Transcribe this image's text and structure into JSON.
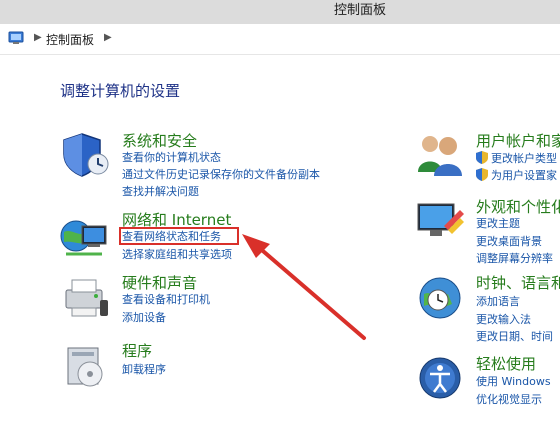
{
  "window": {
    "title": "控制面板"
  },
  "address": {
    "crumb": "控制面板"
  },
  "main": {
    "heading": "调整计算机的设置"
  },
  "left": [
    {
      "title": "系统和安全",
      "icon": "system-security-icon",
      "links": [
        "查看你的计算机状态",
        "通过文件历史记录保存你的文件备份副本",
        "查找并解决问题"
      ]
    },
    {
      "title": "网络和 Internet",
      "icon": "network-internet-icon",
      "links": [
        "查看网络状态和任务",
        "选择家庭组和共享选项"
      ]
    },
    {
      "title": "硬件和声音",
      "icon": "hardware-sound-icon",
      "links": [
        "查看设备和打印机",
        "添加设备"
      ]
    },
    {
      "title": "程序",
      "icon": "programs-icon",
      "links": [
        "卸载程序"
      ]
    }
  ],
  "right": [
    {
      "title": "用户帐户和家",
      "icon": "user-accounts-icon",
      "links": [
        "更改帐户类型",
        "为用户设置家"
      ]
    },
    {
      "title": "外观和个性化",
      "icon": "appearance-icon",
      "links": [
        "更改主题",
        "更改桌面背景",
        "调整屏幕分辨率"
      ]
    },
    {
      "title": "时钟、语言和",
      "icon": "clock-language-icon",
      "links": [
        "添加语言",
        "更改输入法",
        "更改日期、时间"
      ]
    },
    {
      "title": "轻松使用",
      "icon": "ease-of-access-icon",
      "links": [
        "使用 Windows",
        "优化视觉显示"
      ]
    }
  ],
  "colors": {
    "accent_title": "#267c1c",
    "link": "#1a56a8",
    "heading": "#1e3287",
    "annotation": "#d9302a"
  }
}
